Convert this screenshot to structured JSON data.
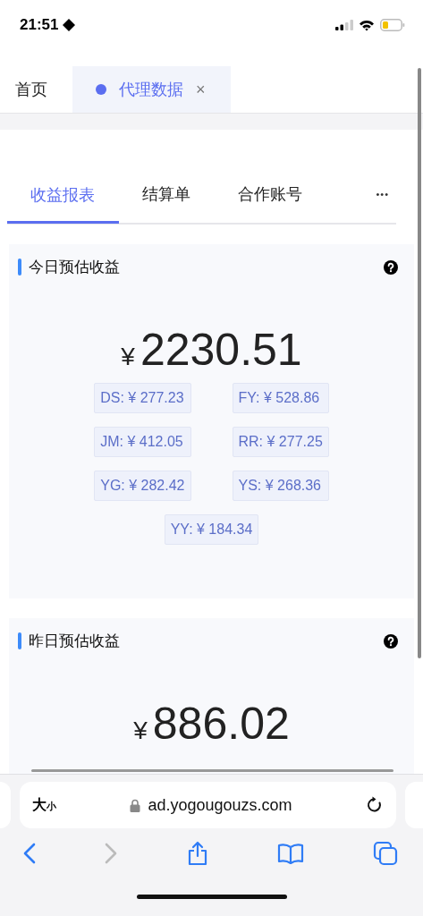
{
  "status_bar": {
    "time": "21:51"
  },
  "page_tabs": [
    {
      "label": "首页",
      "selected": false,
      "closable": false
    },
    {
      "label": "代理数据",
      "selected": true,
      "closable": true
    }
  ],
  "close_glyph": "×",
  "report_tabs": [
    {
      "label": "收益报表",
      "selected": true
    },
    {
      "label": "结算单",
      "selected": false
    },
    {
      "label": "合作账号",
      "selected": false
    }
  ],
  "more_glyph": "•••",
  "cards": [
    {
      "title": "今日预估收益",
      "currency": "¥",
      "amount": "2230.51",
      "chips": [
        "DS: ¥ 277.23",
        "FY: ¥ 528.86",
        "JM: ¥ 412.05",
        "RR: ¥ 277.25",
        "YG: ¥ 282.42",
        "YS: ¥ 268.36",
        "YY: ¥ 184.34"
      ]
    },
    {
      "title": "昨日预估收益",
      "currency": "¥",
      "amount": "886.02"
    }
  ],
  "browser": {
    "text_size": [
      "大",
      "小"
    ],
    "url": "ad.yogougouzs.com"
  }
}
